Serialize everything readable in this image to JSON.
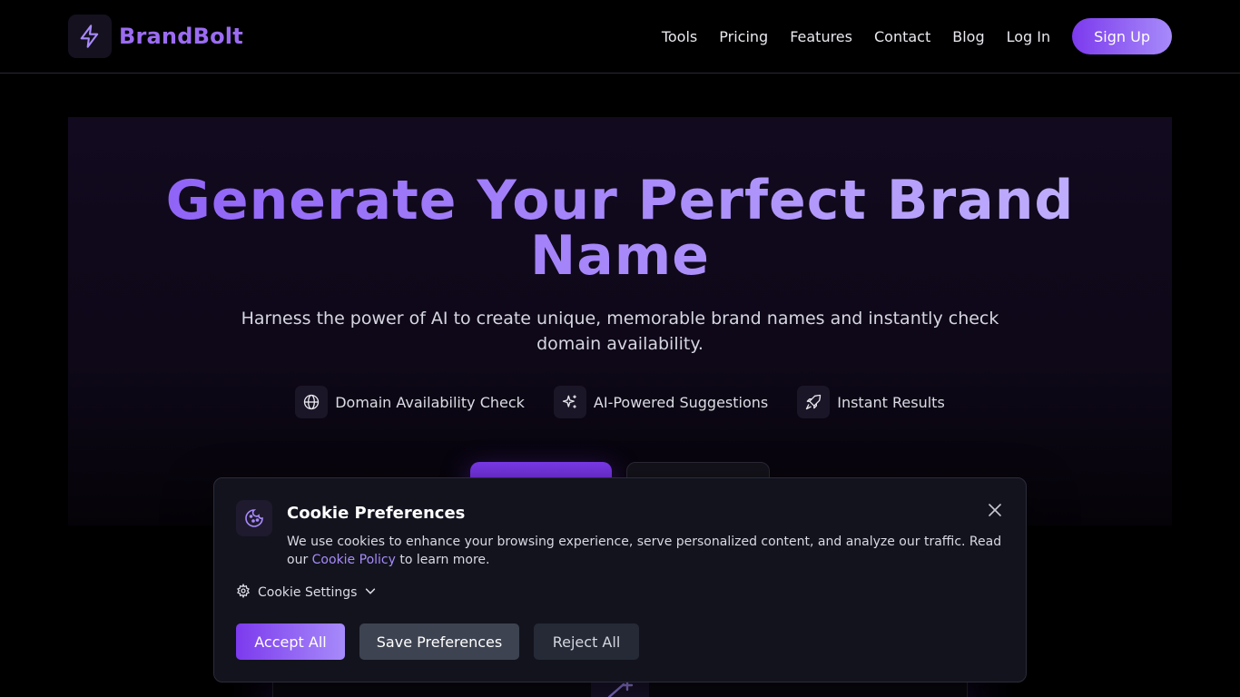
{
  "header": {
    "brand": "BrandBolt",
    "logo_icon": "lightning-bolt-icon",
    "nav": [
      {
        "label": "Tools",
        "name": "nav-tools"
      },
      {
        "label": "Pricing",
        "name": "nav-pricing"
      },
      {
        "label": "Features",
        "name": "nav-features"
      },
      {
        "label": "Contact",
        "name": "nav-contact"
      },
      {
        "label": "Blog",
        "name": "nav-blog"
      },
      {
        "label": "Log In",
        "name": "nav-login"
      }
    ],
    "signup_label": "Sign Up"
  },
  "hero": {
    "title_line1": "Generate Your Perfect Brand",
    "title_line2": "Name",
    "subtitle": "Harness the power of AI to create unique, memorable brand names and instantly check domain availability.",
    "features": [
      {
        "label": "Domain Availability Check",
        "icon": "globe-icon"
      },
      {
        "label": "AI-Powered Suggestions",
        "icon": "sparkles-icon"
      },
      {
        "label": "Instant Results",
        "icon": "rocket-icon"
      }
    ]
  },
  "cookie": {
    "title": "Cookie Preferences",
    "text_before": "We use cookies to enhance your browsing experience, serve personalized content, and analyze our traffic. Read our ",
    "link": "Cookie Policy",
    "text_after": " to learn more.",
    "settings_label": "Cookie Settings",
    "accept_label": "Accept All",
    "save_label": "Save Preferences",
    "reject_label": "Reject All"
  },
  "colors": {
    "accent": "#7c3aed",
    "accent_light": "#a78bfa",
    "background": "#000000",
    "modal_bg": "#12131d"
  }
}
